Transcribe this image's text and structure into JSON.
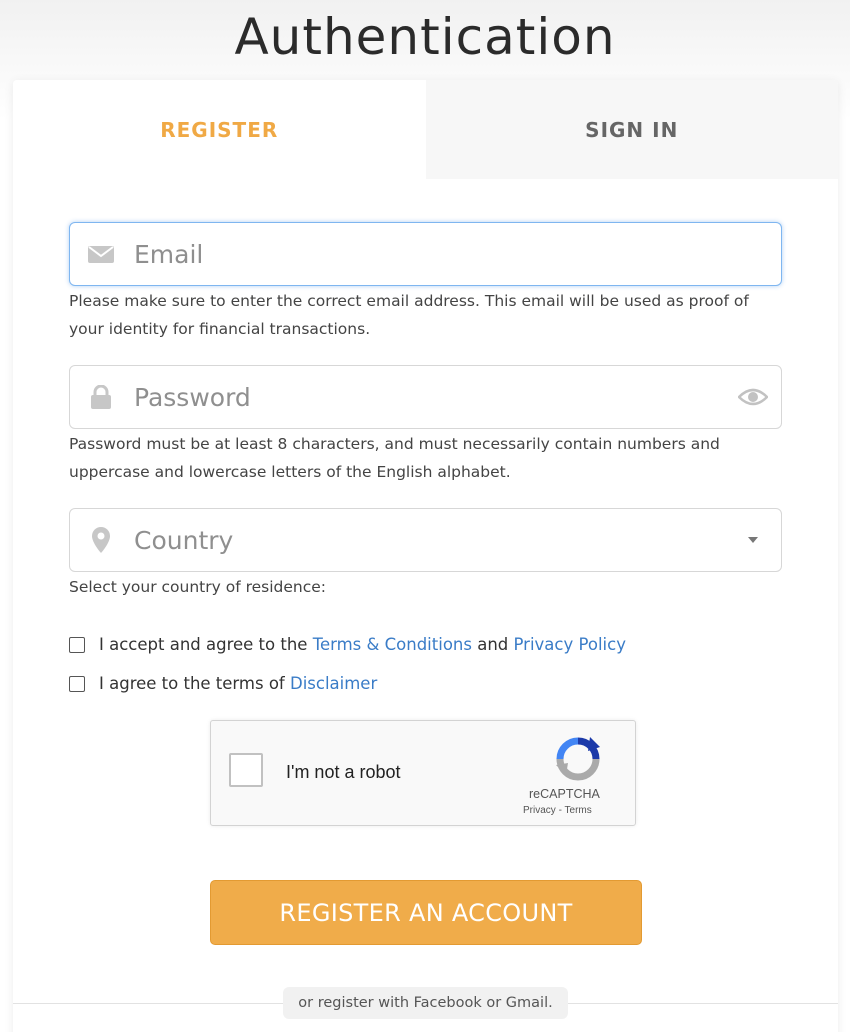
{
  "page": {
    "title": "Authentication"
  },
  "tabs": [
    {
      "label": "REGISTER",
      "active": true
    },
    {
      "label": "SIGN IN",
      "active": false
    }
  ],
  "form": {
    "email": {
      "value": "",
      "placeholder": "Email",
      "icon": "envelope-icon",
      "hint": "Please make sure to enter the correct email address. This email will be used as proof of your identity for financial transactions."
    },
    "password": {
      "value": "",
      "placeholder": "Password",
      "icon": "lock-icon",
      "toggle_icon": "eye-icon",
      "hint": "Password must be at least 8 characters, and must necessarily contain numbers and uppercase and lowercase letters of the English alphabet."
    },
    "country": {
      "value": "",
      "placeholder": "Country",
      "icon": "map-pin-icon",
      "hint": "Select your country of residence:"
    },
    "terms": {
      "checked": false,
      "prefix": "I accept and agree to the",
      "terms_link": "Terms & Conditions",
      "and": "and",
      "privacy_link": "Privacy Policy"
    },
    "disclaimer": {
      "checked": false,
      "prefix": "I agree to the terms of",
      "link": "Disclaimer"
    }
  },
  "recaptcha": {
    "label": "I'm not a robot",
    "brand": "reCAPTCHA",
    "privacy": "Privacy",
    "separator": " - ",
    "terms": "Terms"
  },
  "actions": {
    "register_label": "REGISTER AN ACCOUNT",
    "social_text": "or register with Facebook or Gmail."
  },
  "colors": {
    "accent": "#f0a945",
    "button": "#f0ac4a",
    "link": "#3a7cc7",
    "focus": "#7fb6f0"
  }
}
